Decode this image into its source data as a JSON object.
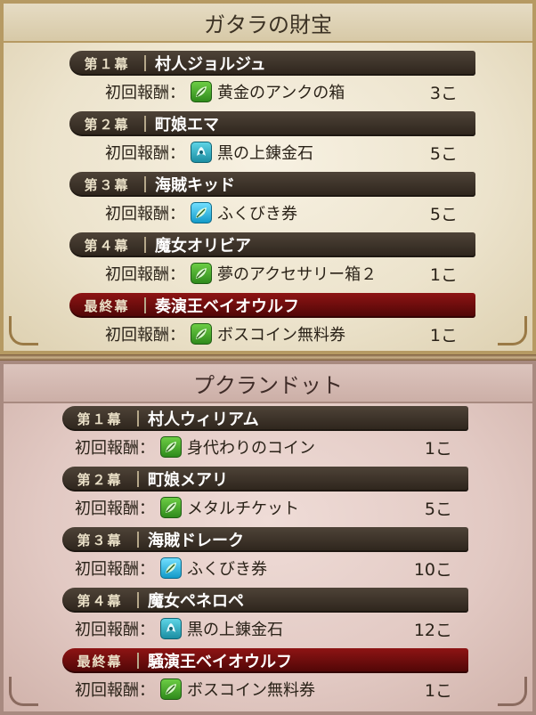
{
  "panels": [
    {
      "title": "ガタラの財宝",
      "stages": [
        {
          "act": "第１幕",
          "name": "村人ジョルジュ",
          "reward_label": "初回報酬：",
          "icon": "green-leaf-icon",
          "item": "黄金のアンクの箱",
          "qty": "3こ",
          "final": false
        },
        {
          "act": "第２幕",
          "name": "町娘エマ",
          "reward_label": "初回報酬：",
          "icon": "teal-orb-icon",
          "item": "黒の上錬金石",
          "qty": "5こ",
          "final": false
        },
        {
          "act": "第３幕",
          "name": "海賊キッド",
          "reward_label": "初回報酬：",
          "icon": "cyan-leaf-icon",
          "item": "ふくびき券",
          "qty": "5こ",
          "final": false
        },
        {
          "act": "第４幕",
          "name": "魔女オリビア",
          "reward_label": "初回報酬：",
          "icon": "green-leaf-icon",
          "item": "夢のアクセサリー箱２",
          "qty": "1こ",
          "final": false
        },
        {
          "act": "最終幕",
          "name": "奏演王ベイオウルフ",
          "reward_label": "初回報酬：",
          "icon": "green-leaf-icon",
          "item": "ボスコイン無料券",
          "qty": "1こ",
          "final": true
        }
      ]
    },
    {
      "title": "プクランドット",
      "stages": [
        {
          "act": "第１幕",
          "name": "村人ウィリアム",
          "reward_label": "初回報酬：",
          "icon": "green-leaf-icon",
          "item": "身代わりのコイン",
          "qty": "1こ",
          "final": false
        },
        {
          "act": "第２幕",
          "name": "町娘メアリ",
          "reward_label": "初回報酬：",
          "icon": "green-leaf-icon",
          "item": "メタルチケット",
          "qty": "5こ",
          "final": false
        },
        {
          "act": "第３幕",
          "name": "海賊ドレーク",
          "reward_label": "初回報酬：",
          "icon": "cyan-leaf-icon",
          "item": "ふくびき券",
          "qty": "10こ",
          "final": false
        },
        {
          "act": "第４幕",
          "name": "魔女ペネロペ",
          "reward_label": "初回報酬：",
          "icon": "teal-orb-icon",
          "item": "黒の上錬金石",
          "qty": "12こ",
          "final": false
        },
        {
          "act": "最終幕",
          "name": "騒演王ベイオウルフ",
          "reward_label": "初回報酬：",
          "icon": "green-leaf-icon",
          "item": "ボスコイン無料券",
          "qty": "1こ",
          "final": true
        }
      ]
    }
  ],
  "colors": {
    "banner_normal": "#2d241b",
    "banner_final": "#6e0c0c",
    "icon_green": "#3fa22a",
    "icon_cyan": "#1ba8d8",
    "icon_teal": "#22a0b4"
  }
}
